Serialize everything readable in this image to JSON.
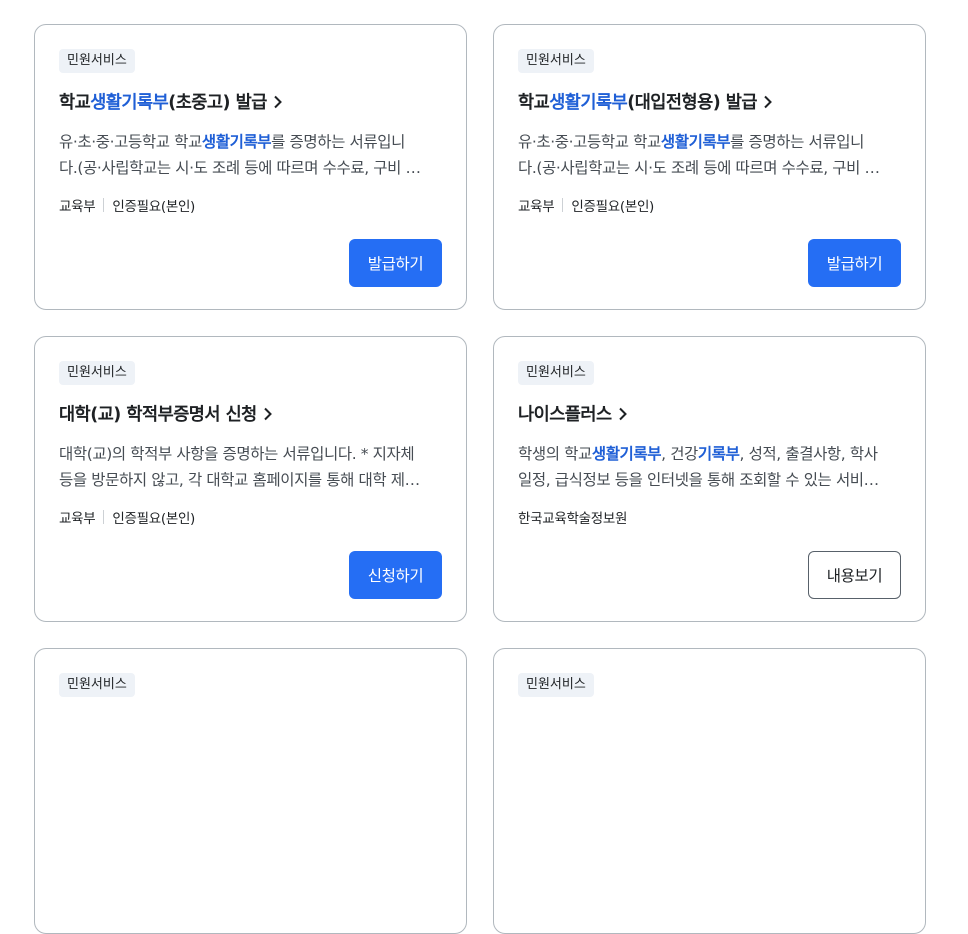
{
  "cards": [
    {
      "badge": "민원서비스",
      "title": {
        "pre": "학교",
        "hl": "생활기록부",
        "post": "(초중고) 발급"
      },
      "desc1": {
        "pre": "유·초·중·고등학교 학교",
        "hl": "생활기록부",
        "post": "를 증명하는 서류입니"
      },
      "desc2": "다.(공·사립학교는 시·도 조례 등에 따르며 수수료, 구비 …",
      "meta1": "교육부",
      "meta2": "인증필요(본인)",
      "button": "발급하기"
    },
    {
      "badge": "민원서비스",
      "title": {
        "pre": "학교",
        "hl": "생활기록부",
        "post": "(대입전형용) 발급"
      },
      "desc1": {
        "pre": "유·초·중·고등학교 학교",
        "hl": "생활기록부",
        "post": "를 증명하는 서류입니"
      },
      "desc2": "다.(공·사립학교는 시·도 조례 등에 따르며 수수료, 구비 …",
      "meta1": "교육부",
      "meta2": "인증필요(본인)",
      "button": "발급하기"
    },
    {
      "badge": "민원서비스",
      "title": {
        "pre": "대학(교) 학적부증명서 신청",
        "hl": "",
        "post": ""
      },
      "desc1": {
        "pre": "대학(교)의 학적부 사항을 증명하는 서류입니다. * 지자체",
        "hl": "",
        "post": ""
      },
      "desc2": "등을 방문하지 않고, 각 대학교 홈페이지를 통해 대학 제…",
      "meta1": "교육부",
      "meta2": "인증필요(본인)",
      "button": "신청하기"
    },
    {
      "badge": "민원서비스",
      "title": {
        "pre": "나이스플러스",
        "hl": "",
        "post": ""
      },
      "desc1": {
        "pre": "학생의 학교",
        "hl": "생활기록부",
        "mid": ", 건강",
        "hl2": "기록부",
        "post": ", 성적, 출결사항, 학사"
      },
      "desc2": "일정, 급식정보 등을 인터넷을 통해 조회할 수 있는 서비…",
      "meta1": "한국교육학술정보원",
      "button": "내용보기"
    },
    {
      "badge": "민원서비스"
    },
    {
      "badge": "민원서비스"
    }
  ]
}
